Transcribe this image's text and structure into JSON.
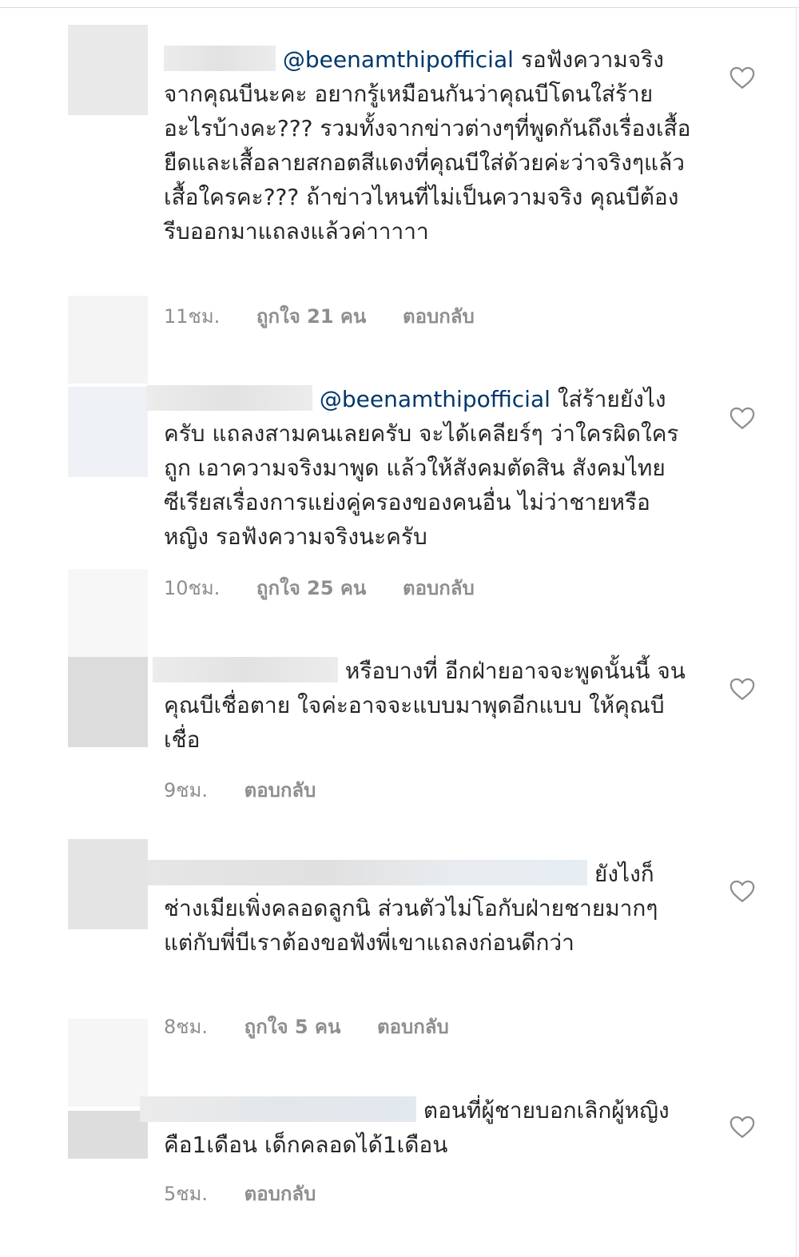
{
  "comments": [
    {
      "mention": "@beenamthipofficial",
      "text": "รอฟังความจริงจากคุณบีนะคะ อยากรู้เหมือนกันว่าคุณบีโดนใส่ร้ายอะไรบ้างคะ??? รวมทั้งจากข่าวต่างๆที่พูดกันถึงเรื่องเสื้อยืดและเสื้อลายสกอตสีแดงที่คุณบีใส่ด้วยค่ะว่าจริงๆแล้วเสื้อใครคะ??? ถ้าข่าวไหนที่ไม่เป็นความจริง คุณบีต้องรีบออกมาแถลงแล้วค่าาาาา",
      "time": "11ชม.",
      "likes": "ถูกใจ 21 คน",
      "reply": "ตอบกลับ"
    },
    {
      "mention": "@beenamthipofficial",
      "text": "ใส่ร้ายยังไงครับ แถลงสามคนเลยครับ จะได้เคลียร์ๆ ว่าใครผิดใครถูก เอาความจริงมาพูด แล้วให้สังคมตัดสิน สังคมไทยซีเรียสเรื่องการแย่งคู่ครองของคนอื่น ไม่ว่าชายหรือหญิง รอฟังความจริงนะครับ",
      "time": "10ชม.",
      "likes": "ถูกใจ 25 คน",
      "reply": "ตอบกลับ"
    },
    {
      "mention": "",
      "text": "หรือบางที่ อีกฝ่ายอาจจะพูดนั้นนี้ จน คุณบีเชื่อตาย ใจค่ะอาจจะแบบมาพุดอีกแบบ ให้คุณบีเชื่อ",
      "time": "9ชม.",
      "likes": "",
      "reply": "ตอบกลับ"
    },
    {
      "mention": "",
      "text": "ยังไงก็ช่างเมียเพิ่งคลอดลูกนิ ส่วนตัวไม่โอกับฝ่ายชายมากๆ แต่กับพี่บีเราต้องขอฟังพี่เขาแถลงก่อนดีกว่า",
      "time": "8ชม.",
      "likes": "ถูกใจ 5 คน",
      "reply": "ตอบกลับ"
    },
    {
      "mention": "",
      "text": "ตอนที่ผู้ชายบอกเลิกผู้หญิงคือ1เดือน เด็กคลอดได้1เดือน",
      "time": "5ชม.",
      "likes": "",
      "reply": "ตอบกลับ"
    }
  ],
  "icons": {
    "like": "heart-outline-icon"
  },
  "colors": {
    "mention": "#00376b",
    "meta": "#8e8e8e",
    "text": "#262626"
  }
}
